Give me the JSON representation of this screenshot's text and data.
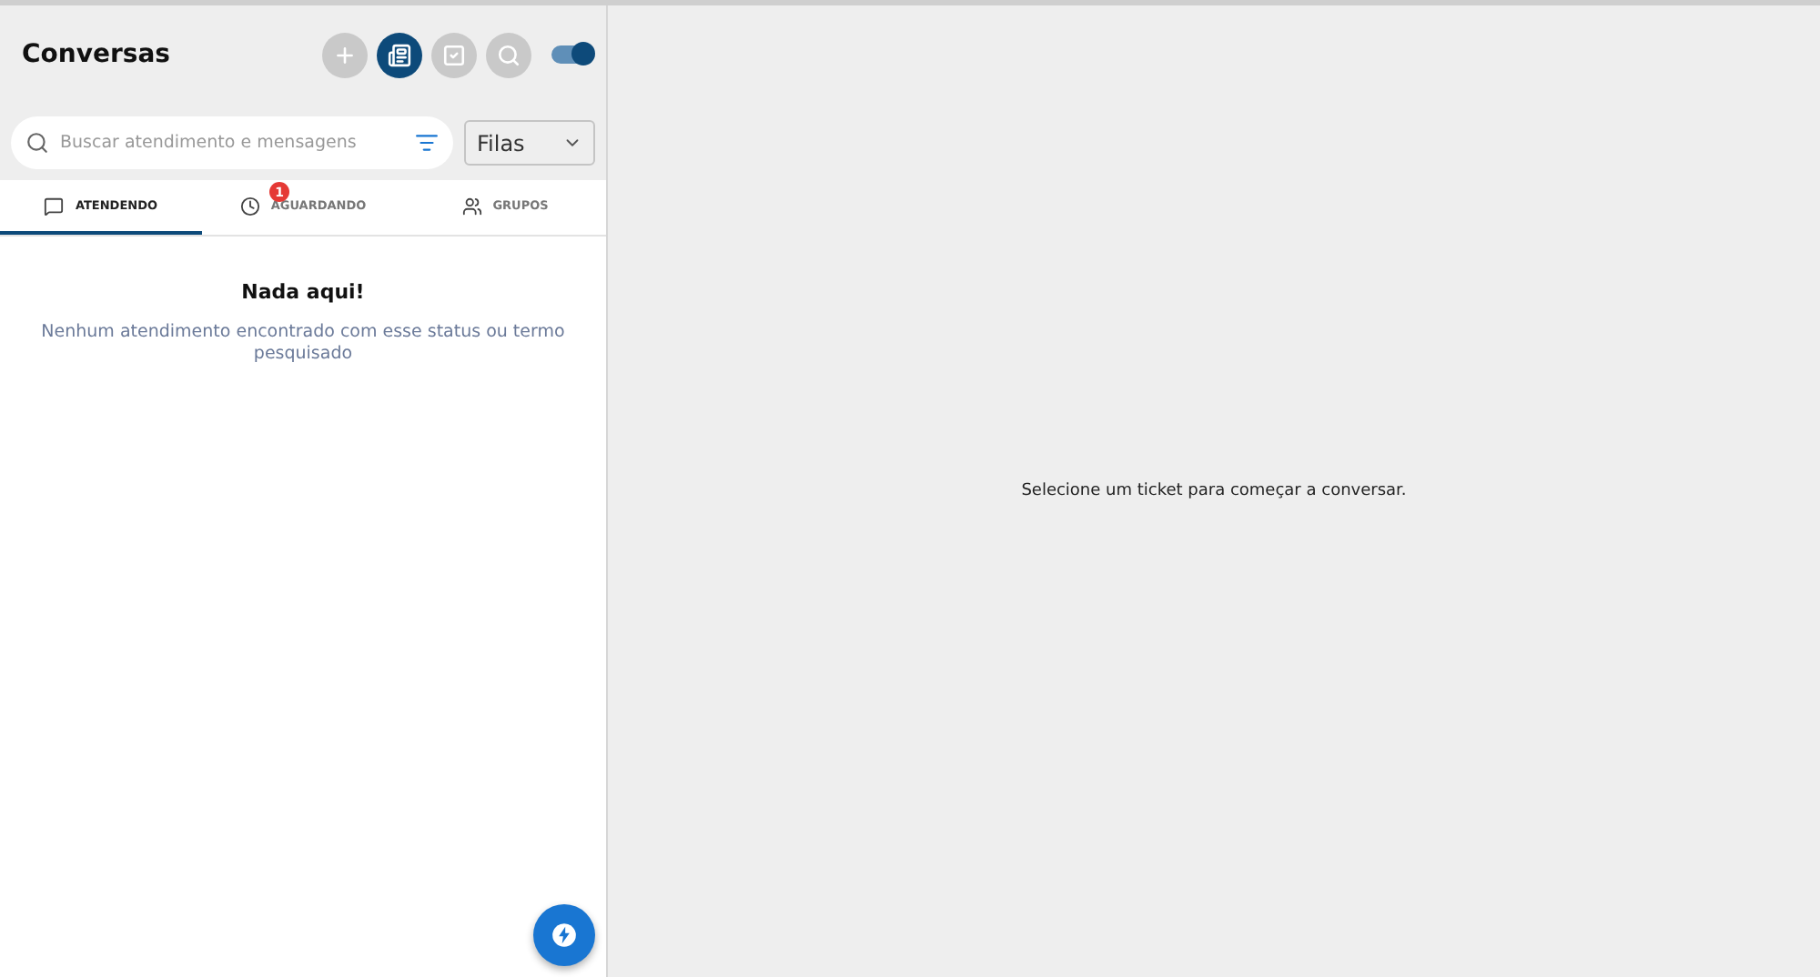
{
  "sidebar": {
    "title": "Conversas",
    "header_buttons": [
      {
        "kind": "plus",
        "selected": false
      },
      {
        "kind": "list",
        "selected": true
      },
      {
        "kind": "check",
        "selected": false
      },
      {
        "kind": "search",
        "selected": false
      }
    ],
    "toggle": {
      "on": true
    },
    "search": {
      "placeholder": "Buscar atendimento e mensagens"
    },
    "queue_select": {
      "value": "Filas"
    },
    "tabs": [
      {
        "kind": "chat",
        "label": "ATENDENDO",
        "selected": true
      },
      {
        "kind": "clock",
        "label": "AGUARDANDO",
        "selected": false,
        "badge": "1"
      },
      {
        "kind": "people",
        "label": "GRUPOS",
        "selected": false
      }
    ],
    "empty": {
      "title": "Nada aqui!",
      "message": "Nenhum atendimento encontrado com esse status ou termo pesquisado"
    }
  },
  "main": {
    "message": "Selecione um ticket para começar a conversar."
  }
}
